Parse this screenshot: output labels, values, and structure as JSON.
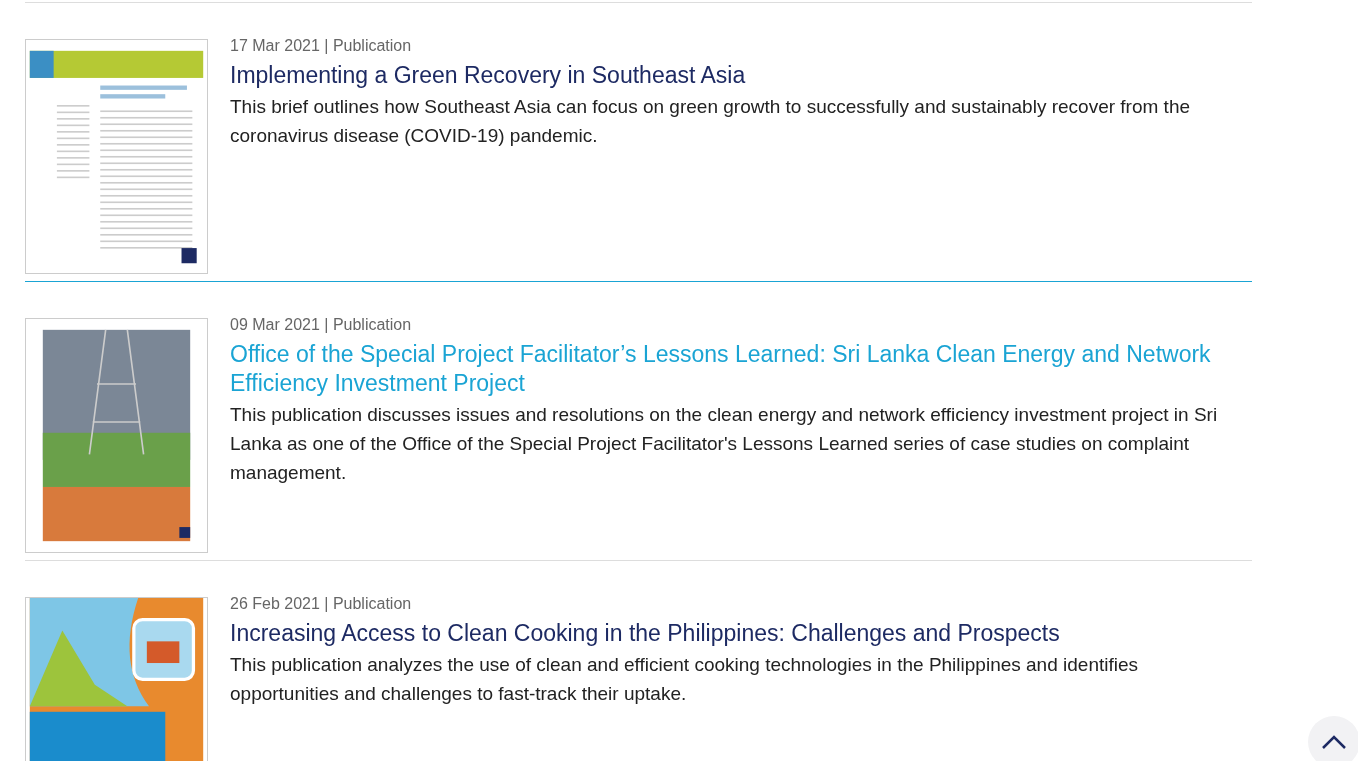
{
  "publications": [
    {
      "meta": "17 Mar 2021 | Publication",
      "title": "Implementing a Green Recovery in Southeast Asia",
      "summary": "This brief outlines how Southeast Asia can focus on green growth to successfully and sustainably recover from the coronavirus disease (COVID-19) pandemic.",
      "hovered": false,
      "kind": "brief"
    },
    {
      "meta": "09 Mar 2021 | Publication",
      "title": "Office of the Special Project Facilitator’s Lessons Learned: Sri Lanka Clean Energy and Network Efficiency Investment Project",
      "summary": "This publication discusses issues and resolutions on the clean energy and network efficiency investment project in Sri Lanka as one of the Office of the Special Project Facilitator's Lessons Learned series of case studies on complaint management.",
      "hovered": true,
      "kind": "photo"
    },
    {
      "meta": "26 Feb 2021 | Publication",
      "title": "Increasing Access to Clean Cooking in the Philippines: Challenges and Prospects",
      "summary": "This publication analyzes the use of clean and efficient cooking technologies in the Philippines and identifies opportunities and challenges to fast-track their uptake.",
      "hovered": false,
      "kind": "illustration"
    }
  ]
}
